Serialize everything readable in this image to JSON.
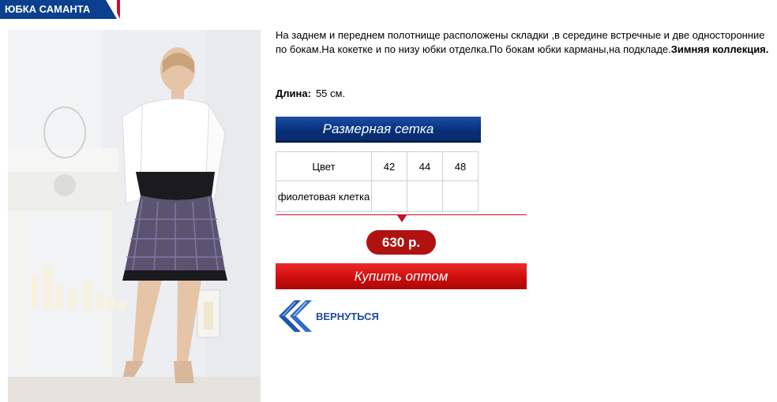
{
  "header": {
    "title": "ЮБКА САМАНТА"
  },
  "product": {
    "description": " На заднем и переднем полотнище расположены складки ,в середине встречные и две односторонние по бокам.На кокетке и по низу юбки отделка.По бокам юбки карманы,на подкладе.",
    "collection": "Зимняя коллекция.",
    "length_label": "Длина:",
    "length_value": "55 см.",
    "price": "630 р."
  },
  "size_table": {
    "title": "Размерная сетка",
    "header": [
      "Цвет",
      "42",
      "44",
      "48"
    ],
    "rows": [
      {
        "color": "фиолетовая клетка",
        "cells": [
          "",
          "",
          ""
        ]
      }
    ]
  },
  "actions": {
    "buy_label": "Купить оптом",
    "back_label": "ВЕРНУТЬСЯ"
  },
  "colors": {
    "brand_blue": "#0b3f8f",
    "brand_red": "#c8102e"
  },
  "icons": {
    "back": "double-chevron-left-icon"
  }
}
